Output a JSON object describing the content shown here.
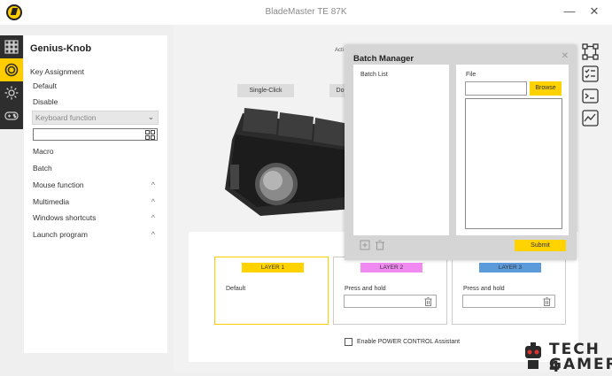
{
  "window": {
    "title": "BladeMaster TE 87K",
    "minimize_glyph": "—",
    "close_glyph": "✕"
  },
  "sidebar_icons": [
    {
      "name": "grid-icon",
      "active": false
    },
    {
      "name": "knob-icon",
      "active": true
    },
    {
      "name": "light-icon",
      "active": false
    },
    {
      "name": "gamepad-icon",
      "active": false
    }
  ],
  "panel": {
    "title": "Genius-Knob",
    "section_label": "Key Assignment",
    "default_label": "Default",
    "disable_label": "Disable",
    "keyboard_function": "Keyboard function",
    "macro_label": "Macro",
    "batch_label": "Batch",
    "mouse_function": "Mouse function",
    "multimedia": "Multimedia",
    "windows_shortcuts": "Windows shortcuts",
    "launch_program": "Launch program",
    "chevron_glyph": "^"
  },
  "main": {
    "action_label_partial": "Acti",
    "single_click_label": "Single-Click",
    "double_click_label_partial": "Do",
    "layers": [
      {
        "tag": "LAYER 1",
        "color": "#ffd200",
        "text": "Default",
        "selected": true,
        "has_field": false
      },
      {
        "tag": "LAYER 2",
        "color": "#f08af0",
        "text": "Press and hold",
        "selected": false,
        "has_field": true
      },
      {
        "tag": "LAYER 3",
        "color": "#5b9bdc",
        "text": "Press and hold",
        "selected": false,
        "has_field": true
      }
    ],
    "enable_power_control": "Enable POWER CONTROL Assistant"
  },
  "right_icons": [
    "network-icon",
    "checklist-icon",
    "terminal-icon",
    "activity-icon"
  ],
  "dialog": {
    "title": "Batch Manager",
    "close_glyph": "✕",
    "batch_list_label": "Batch List",
    "file_label": "File",
    "browse_label": "Browse",
    "submit_label": "Submit"
  },
  "watermark": {
    "line1": "TECH 4",
    "line2": "GAMERS"
  },
  "colors": {
    "accent": "#ffcc00",
    "sidebar_dark": "#2e2e2e"
  }
}
